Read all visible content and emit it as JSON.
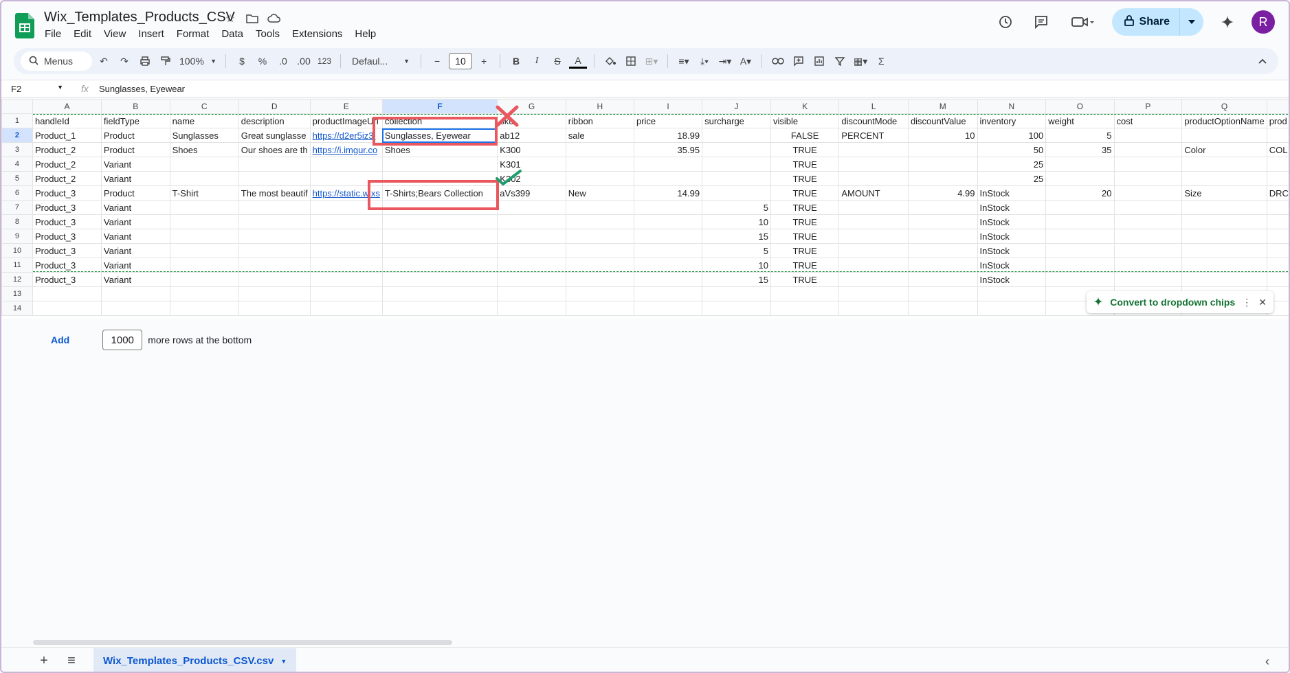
{
  "app": {
    "title": "Wix_Templates_Products_CSV",
    "menus": [
      "File",
      "Edit",
      "View",
      "Insert",
      "Format",
      "Data",
      "Tools",
      "Extensions",
      "Help"
    ],
    "share_label": "Share",
    "avatar_initial": "R",
    "accent": "#0b57d0",
    "share_bg": "#c2e7ff"
  },
  "toolbar": {
    "search_label": "Menus",
    "zoom": "100%",
    "currency": "$",
    "percent": "%",
    "dec_decrease": ".0",
    "dec_increase": ".00",
    "number_format": "123",
    "font": "Defaul...",
    "font_size": "10",
    "bold": "B",
    "italic": "I",
    "strike": "S",
    "text_color": "A",
    "sigma": "Σ"
  },
  "formula_bar": {
    "cell_ref": "F2",
    "fx": "fx",
    "value": "Sunglasses, Eyewear"
  },
  "grid": {
    "columns": [
      "A",
      "B",
      "C",
      "D",
      "E",
      "F",
      "G",
      "H",
      "I",
      "J",
      "K",
      "L",
      "M",
      "N",
      "O",
      "P",
      "Q",
      ""
    ],
    "rows": [
      [
        "handleId",
        "fieldType",
        "name",
        "description",
        "productImageUrl",
        "collection",
        "sku",
        "ribbon",
        "price",
        "surcharge",
        "visible",
        "discountMode",
        "discountValue",
        "inventory",
        "weight",
        "cost",
        "productOptionName",
        "prod"
      ],
      [
        "Product_1",
        "Product",
        "Sunglasses",
        "Great sunglasse",
        "https://d2er5iz3i",
        "Sunglasses, Eyewear",
        "ab12",
        "sale",
        "18.99",
        "",
        "FALSE",
        "PERCENT",
        "10",
        "100",
        "5",
        "",
        "",
        ""
      ],
      [
        "Product_2",
        "Product",
        "Shoes",
        "Our shoes are th",
        "https://i.imgur.co",
        "Shoes",
        "K300",
        "",
        "35.95",
        "",
        "TRUE",
        "",
        "",
        "50",
        "35",
        "",
        "Color",
        "COL"
      ],
      [
        "Product_2",
        "Variant",
        "",
        "",
        "",
        "",
        "K301",
        "",
        "",
        "",
        "TRUE",
        "",
        "",
        "25",
        "",
        "",
        "",
        ""
      ],
      [
        "Product_2",
        "Variant",
        "",
        "",
        "",
        "",
        "K302",
        "",
        "",
        "",
        "TRUE",
        "",
        "",
        "25",
        "",
        "",
        "",
        ""
      ],
      [
        "Product_3",
        "Product",
        "T-Shirt",
        "The most beautif",
        "https://static.wixs",
        "T-Shirts;Bears Collection",
        "aVs399",
        "New",
        "14.99",
        "",
        "TRUE",
        "AMOUNT",
        "4.99",
        "InStock",
        "20",
        "",
        "Size",
        "DRC"
      ],
      [
        "Product_3",
        "Variant",
        "",
        "",
        "",
        "",
        "",
        "",
        "",
        "5",
        "TRUE",
        "",
        "",
        "InStock",
        "",
        "",
        "",
        ""
      ],
      [
        "Product_3",
        "Variant",
        "",
        "",
        "",
        "",
        "",
        "",
        "",
        "10",
        "TRUE",
        "",
        "",
        "InStock",
        "",
        "",
        "",
        ""
      ],
      [
        "Product_3",
        "Variant",
        "",
        "",
        "",
        "",
        "",
        "",
        "",
        "15",
        "TRUE",
        "",
        "",
        "InStock",
        "",
        "",
        "",
        ""
      ],
      [
        "Product_3",
        "Variant",
        "",
        "",
        "",
        "",
        "",
        "",
        "",
        "5",
        "TRUE",
        "",
        "",
        "InStock",
        "",
        "",
        "",
        ""
      ],
      [
        "Product_3",
        "Variant",
        "",
        "",
        "",
        "",
        "",
        "",
        "",
        "10",
        "TRUE",
        "",
        "",
        "InStock",
        "",
        "",
        "",
        ""
      ],
      [
        "Product_3",
        "Variant",
        "",
        "",
        "",
        "",
        "",
        "",
        "",
        "15",
        "TRUE",
        "",
        "",
        "InStock",
        "",
        "",
        "",
        ""
      ],
      [
        "",
        "",
        "",
        "",
        "",
        "",
        "",
        "",
        "",
        "",
        "",
        "",
        "",
        "",
        "",
        "",
        "",
        ""
      ],
      [
        "",
        "",
        "",
        "",
        "",
        "",
        "",
        "",
        "",
        "",
        "",
        "",
        "",
        "",
        "",
        "",
        "",
        ""
      ]
    ]
  },
  "chip_popup": {
    "label": "Convert to dropdown chips"
  },
  "add_rows": {
    "add_label": "Add",
    "count": "1000",
    "suffix": "more rows at the bottom"
  },
  "sheet_tab": {
    "name": "Wix_Templates_Products_CSV.csv"
  },
  "annotations": {
    "wrong_color": "#e8585e",
    "right_color": "#1e9e6e"
  }
}
